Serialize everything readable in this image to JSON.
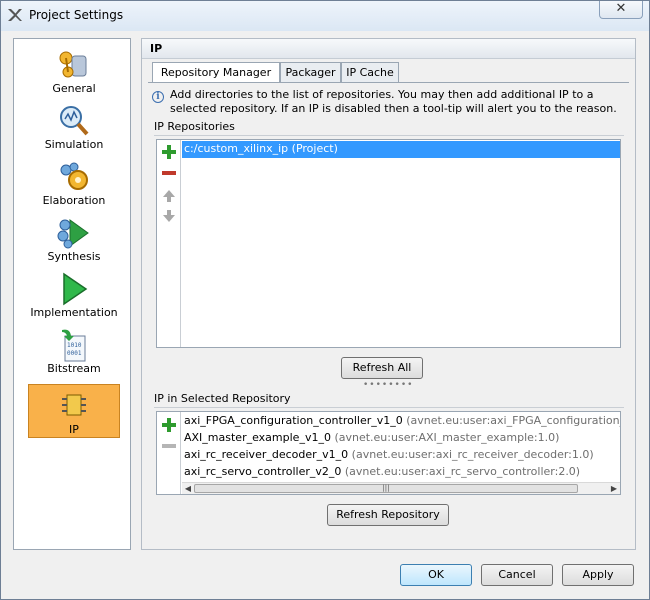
{
  "window": {
    "title": "Project Settings",
    "close_glyph": "✕"
  },
  "nav": {
    "items": [
      {
        "label": "General",
        "icon": "general-icon",
        "selected": false
      },
      {
        "label": "Simulation",
        "icon": "simulation-icon",
        "selected": false
      },
      {
        "label": "Elaboration",
        "icon": "elaboration-icon",
        "selected": false
      },
      {
        "label": "Synthesis",
        "icon": "synthesis-icon",
        "selected": false
      },
      {
        "label": "Implementation",
        "icon": "implementation-icon",
        "selected": false
      },
      {
        "label": "Bitstream",
        "icon": "bitstream-icon",
        "selected": false
      },
      {
        "label": "IP",
        "icon": "ip-icon",
        "selected": true
      }
    ]
  },
  "panel": {
    "title": "IP",
    "tabs": [
      {
        "label": "Repository Manager",
        "active": true
      },
      {
        "label": "Packager",
        "active": false
      },
      {
        "label": "IP Cache",
        "active": false
      }
    ],
    "info_text": "Add directories to the list of repositories. You may then add additional IP to a selected repository. If an IP is disabled then a tool-tip will alert you to the reason.",
    "repositories": {
      "label": "IP Repositories",
      "items": [
        "c:/custom_xilinx_ip (Project)"
      ],
      "refresh_all_label": "Refresh All"
    },
    "selected_repo_ip": {
      "label": "IP in Selected Repository",
      "items": [
        {
          "name": "axi_FPGA_configuration_controller_v1_0",
          "vlnv": "(avnet.eu:user:axi_FPGA_configuration_controlle"
        },
        {
          "name": "AXI_master_example_v1_0",
          "vlnv": "(avnet.eu:user:AXI_master_example:1.0)"
        },
        {
          "name": "axi_rc_receiver_decoder_v1_0",
          "vlnv": "(avnet.eu:user:axi_rc_receiver_decoder:1.0)"
        },
        {
          "name": "axi_rc_servo_controller_v2_0",
          "vlnv": "(avnet.eu:user:axi_rc_servo_controller:2.0)"
        }
      ],
      "refresh_repository_label": "Refresh Repository"
    }
  },
  "footer": {
    "ok_label": "OK",
    "cancel_label": "Cancel",
    "apply_label": "Apply"
  },
  "colors": {
    "selection": "#3399ff",
    "nav_selected": "#f9b14a",
    "add_green": "#2e9b2e",
    "remove_red": "#c0392b"
  }
}
